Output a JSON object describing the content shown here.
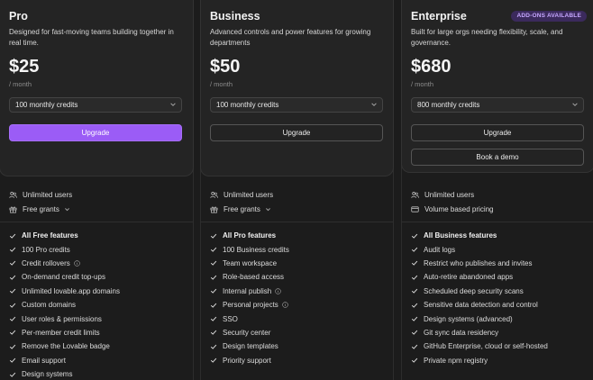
{
  "plans": [
    {
      "name": "Pro",
      "description": "Designed for fast-moving teams building together in real time.",
      "price": "$25",
      "period": "/ month",
      "credits_select": "100 monthly credits",
      "upgrade_label": "Upgrade",
      "meta": [
        "Unlimited users",
        "Free grants"
      ],
      "features": [
        {
          "label": "All Free features",
          "bold": true
        },
        {
          "label": "100 Pro credits"
        },
        {
          "label": "Credit rollovers",
          "info": true
        },
        {
          "label": "On-demand credit top-ups"
        },
        {
          "label": "Unlimited lovable.app domains"
        },
        {
          "label": "Custom domains"
        },
        {
          "label": "User roles & permissions"
        },
        {
          "label": "Per-member credit limits"
        },
        {
          "label": "Remove the Lovable badge"
        },
        {
          "label": "Email support"
        },
        {
          "label": "Design systems"
        }
      ]
    },
    {
      "name": "Business",
      "description": "Advanced controls and power features for growing departments",
      "price": "$50",
      "period": "/ month",
      "credits_select": "100 monthly credits",
      "upgrade_label": "Upgrade",
      "meta": [
        "Unlimited users",
        "Free grants"
      ],
      "features": [
        {
          "label": "All Pro features",
          "bold": true
        },
        {
          "label": "100 Business credits"
        },
        {
          "label": "Team workspace"
        },
        {
          "label": "Role-based access"
        },
        {
          "label": "Internal publish",
          "info": true
        },
        {
          "label": "Personal projects",
          "info": true
        },
        {
          "label": "SSO"
        },
        {
          "label": "Security center"
        },
        {
          "label": "Design templates"
        },
        {
          "label": "Priority support"
        }
      ]
    },
    {
      "name": "Enterprise",
      "badge": "ADD-ONS AVAILABLE",
      "description": "Built for large orgs needing flexibility, scale, and governance.",
      "price": "$680",
      "period": "/ month",
      "credits_select": "800 monthly credits",
      "upgrade_label": "Upgrade",
      "demo_label": "Book a demo",
      "meta": [
        "Unlimited users",
        "Volume based pricing"
      ],
      "features": [
        {
          "label": "All Business features",
          "bold": true
        },
        {
          "label": "Audit logs"
        },
        {
          "label": "Restrict who publishes and invites"
        },
        {
          "label": "Auto-retire abandoned apps"
        },
        {
          "label": "Scheduled deep security scans"
        },
        {
          "label": "Sensitive data detection and control"
        },
        {
          "label": "Design systems (advanced)"
        },
        {
          "label": "Git sync data residency"
        },
        {
          "label": "GitHub Enterprise, cloud or self-hosted"
        },
        {
          "label": "Private npm registry"
        }
      ]
    }
  ],
  "colors": {
    "accent": "#9b5cf6",
    "background": "#1c1c1c",
    "card": "#242424",
    "badge_bg": "#3b2a5c",
    "badge_text": "#c7a8ff"
  },
  "icons": {
    "users": "users-icon",
    "grants": "gift-icon",
    "pricing": "card-icon",
    "check": "check-icon",
    "info": "info-icon",
    "chevron": "chevron-down-icon"
  }
}
